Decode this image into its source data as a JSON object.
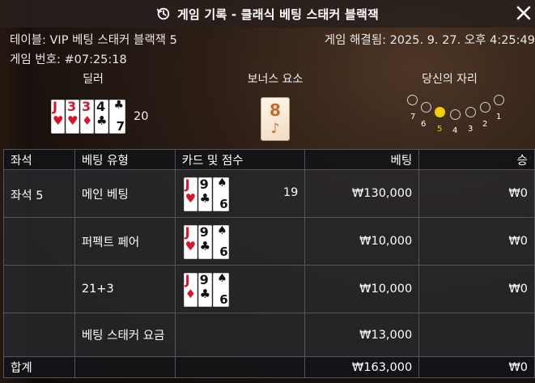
{
  "header": {
    "title": "게임 기록 - 클래식 베팅 스태커 블랙잭",
    "history_icon": "history-clock-icon",
    "close_icon": "close-icon"
  },
  "info": {
    "table": "테이블: VIP 베팅 스태커 블랙잭 5",
    "resolved": "게임 해결됨: 2025. 9. 27. 오후 4:25:49",
    "game_no": "게임 번호: #07:25:18"
  },
  "sections": {
    "dealer": "딜러",
    "bonus": "보너스 요소",
    "your_seat": "당신의 자리"
  },
  "dealer": {
    "cards": [
      {
        "rank": "J",
        "suit": "♥",
        "color": "red"
      },
      {
        "rank": "3",
        "suit": "♥",
        "color": "red"
      },
      {
        "rank": "3",
        "suit": "♦",
        "color": "red"
      },
      {
        "rank": "4",
        "suit": "♣",
        "color": "black"
      },
      {
        "rank": "7",
        "suit": "♣",
        "color": "black"
      }
    ],
    "score": "20"
  },
  "bonus": {
    "value": "8",
    "symbol": "♪"
  },
  "seats": {
    "labels": [
      "7",
      "6",
      "5",
      "4",
      "3",
      "2",
      "1"
    ],
    "active": "5",
    "active_color": "#f0d000"
  },
  "table": {
    "headers": {
      "seat": "좌석",
      "bet_type": "베팅 유형",
      "cards_score": "카드 및 점수",
      "bet": "베팅",
      "win": "승"
    },
    "rows": [
      {
        "seat": "좌석 5",
        "bet_type": "메인 베팅",
        "cards": [
          "J♥",
          "9♣",
          "6♠"
        ],
        "score": "19",
        "bet": "₩130,000",
        "win": "₩0"
      },
      {
        "seat": "",
        "bet_type": "퍼펙트 페어",
        "cards": [
          "J♥",
          "9♣",
          "6♠"
        ],
        "score": "",
        "bet": "₩10,000",
        "win": "₩0"
      },
      {
        "seat": "",
        "bet_type": "21+3",
        "cards": [
          "J♦",
          "9♣",
          "6♠"
        ],
        "score": "",
        "bet": "₩10,000",
        "win": "₩0"
      },
      {
        "seat": "",
        "bet_type": "베팅 스태커 요금",
        "cards": [],
        "score": "",
        "bet": "₩13,000",
        "win": ""
      }
    ],
    "total": {
      "label": "합계",
      "bet": "₩163,000",
      "win": "₩0"
    }
  }
}
